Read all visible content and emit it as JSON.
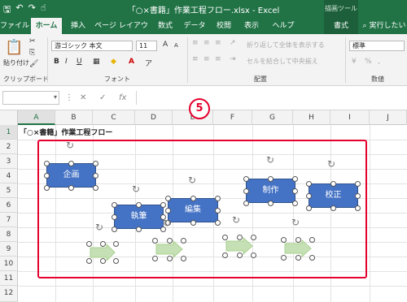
{
  "app": {
    "title": "「○×書籍」作業工程フロー.xlsx - Excel",
    "contextual_tab_group": "描画ツール",
    "tell_me": "実行したい"
  },
  "tabs": [
    "ファイル",
    "ホーム",
    "挿入",
    "ページ レイアウト",
    "数式",
    "データ",
    "校閲",
    "表示",
    "ヘルプ",
    "書式"
  ],
  "ribbon": {
    "paste_label": "貼り付け",
    "clipboard_label": "クリップボード",
    "font_name": "游ゴシック 本文",
    "font_size": "11",
    "font_group_label": "フォント",
    "bold": "B",
    "italic": "I",
    "underline": "U",
    "wrap_text": "折り返して全体を表示する",
    "merge_center": "セルを結合して中央揃え",
    "alignment_label": "配置",
    "number_format": "標準",
    "number_label": "数値",
    "grow_font": "A",
    "shrink_font": "A"
  },
  "formula_bar": {
    "cancel": "✕",
    "enter": "✓",
    "fx": "fx"
  },
  "columns": [
    "A",
    "B",
    "C",
    "D",
    "E",
    "F",
    "G",
    "H",
    "I",
    "J"
  ],
  "rows": [
    "1",
    "2",
    "3",
    "4",
    "5",
    "6",
    "7",
    "8",
    "9",
    "10",
    "11",
    "12"
  ],
  "cells": {
    "A1": "「○×書籍」作業工程フロー"
  },
  "shapes": {
    "s1": "企画",
    "s2": "執筆",
    "s3": "編集",
    "s4": "制作",
    "s5": "校正"
  },
  "annotation": {
    "badge": "5"
  },
  "colors": {
    "excel_green": "#217346",
    "shape_blue": "#4472c4",
    "arrow_green": "#c5e0b4",
    "highlight_red": "#e5002d"
  }
}
